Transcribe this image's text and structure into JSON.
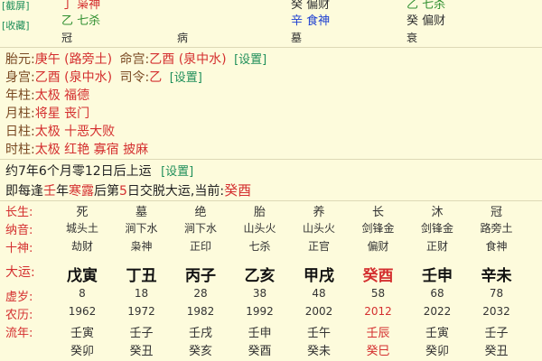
{
  "top_partial": {
    "label1": "[截屏]",
    "label2": "[收藏]",
    "col1_line1": "丁 枭神",
    "col1_line2": "乙 七杀",
    "col1_line3": "冠",
    "col2_line3": "病",
    "col3_line1": "癸 偏财",
    "col3_line2": "辛 食神",
    "col3_line3": "墓",
    "col4_line1": "乙 七杀",
    "col4_line2": "癸 偏财",
    "col4_line3": "衰"
  },
  "info": {
    "taiyuan_key": "胎元:",
    "taiyuan_val": "庚午 (路旁土)",
    "minggong_key": "命宫:",
    "minggong_val": "乙酉 (泉中水)",
    "setting": "[设置]",
    "shengong_key": "身宫:",
    "shengong_val": "乙酉 (泉中水)",
    "siling_key": "司令:",
    "siling_val": "乙",
    "nianzhu_key": "年柱:",
    "nianzhu_val": "太极 福德",
    "yuezhu_key": "月柱:",
    "yuezhu_val": "将星 丧门",
    "rizhu_key": "日柱:",
    "rizhu_val": "太极 十恶大败",
    "shizhu_key": "时柱:",
    "shizhu_val": "太极 红艳 寡宿 披麻"
  },
  "yun": {
    "line1": "约7年6个月零12日后上运",
    "line2_a": "即每逢",
    "line2_b": "壬",
    "line2_c": "年",
    "line2_d": "寒露",
    "line2_e": "后第",
    "line2_f": "5",
    "line2_g": "日交脱大运,当前:",
    "line2_cur": "癸酉"
  },
  "table": {
    "labels": {
      "changsheng": "长生:",
      "nayin": "纳音:",
      "shishen": "十神:",
      "dayun": "大运:",
      "xusui": "虚岁:",
      "nongli": "农历:",
      "liunian": "流年:"
    },
    "columns": [
      {
        "cs": "死",
        "ny": "城头土",
        "ss": "劫财",
        "dy": "戊寅",
        "xs": "8",
        "nl": "1962",
        "ln1": "壬寅",
        "ln2": "癸卯",
        "current": false
      },
      {
        "cs": "墓",
        "ny": "涧下水",
        "ss": "枭神",
        "dy": "丁丑",
        "xs": "18",
        "nl": "1972",
        "ln1": "壬子",
        "ln2": "癸丑",
        "current": false
      },
      {
        "cs": "绝",
        "ny": "涧下水",
        "ss": "正印",
        "dy": "丙子",
        "xs": "28",
        "nl": "1982",
        "ln1": "壬戌",
        "ln2": "癸亥",
        "current": false
      },
      {
        "cs": "胎",
        "ny": "山头火",
        "ss": "七杀",
        "dy": "乙亥",
        "xs": "38",
        "nl": "1992",
        "ln1": "壬申",
        "ln2": "癸酉",
        "current": false
      },
      {
        "cs": "养",
        "ny": "山头火",
        "ss": "正官",
        "dy": "甲戌",
        "xs": "48",
        "nl": "2002",
        "ln1": "壬午",
        "ln2": "癸未",
        "current": false
      },
      {
        "cs": "长",
        "ny": "剑锋金",
        "ss": "偏财",
        "dy": "癸酉",
        "xs": "58",
        "nl": "2012",
        "ln1": "壬辰",
        "ln2": "癸巳",
        "current": true
      },
      {
        "cs": "沐",
        "ny": "剑锋金",
        "ss": "正财",
        "dy": "壬申",
        "xs": "68",
        "nl": "2022",
        "ln1": "壬寅",
        "ln2": "癸卯",
        "current": false
      },
      {
        "cs": "冠",
        "ny": "路旁土",
        "ss": "食神",
        "dy": "辛未",
        "xs": "78",
        "nl": "2032",
        "ln1": "壬子",
        "ln2": "癸丑",
        "current": false
      }
    ]
  },
  "colors": {
    "background": "#fdfbdc",
    "label_brown": "#7a4a23",
    "value_red": "#d42f2f",
    "link_green": "#1f8f5a",
    "blue": "#1d3fd1"
  }
}
